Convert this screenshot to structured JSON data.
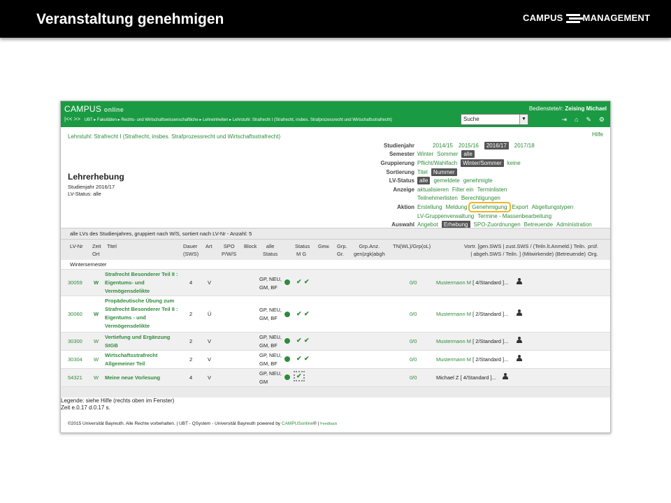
{
  "slide": {
    "title": "Veranstaltung genehmigen",
    "logo_text_left": "CAMPUS",
    "logo_text_right": "MANAGEMENT"
  },
  "app": {
    "logo_campus": "CAMPUS",
    "logo_online": "online",
    "user_label": "Bedienstete/r:",
    "user_name": "Zeising Michael",
    "breadcrumb": [
      "UBT",
      "Fakultäten",
      "Rechts- und Wirtschaftswissenschaftliche",
      "Lehreinheiten",
      "Lehrstuhl: Strafrecht I (Strafrecht, insbes. Strafprozessrecht und Wirtschaftsstrafrecht)"
    ],
    "search_value": "Suche",
    "hilfe": "Hilfe"
  },
  "lehrstuhl_title": "Lehrstuhl: Strafrecht I (Strafrecht, insbes. Strafprozessrecht und Wirtschaftsstrafrecht)",
  "page": {
    "heading": "Lehrerhebung",
    "sub1": "Studienjahr 2016/17",
    "sub2": "LV-Status: alle"
  },
  "controls": {
    "studienjahr": {
      "label": "Studienjahr",
      "options": [
        "2014/15",
        "2015/16",
        "2016/17",
        "2017/18"
      ],
      "selected": "2016/17"
    },
    "semester": {
      "label": "Semester",
      "options": [
        "Winter",
        "Sommer",
        "alle"
      ],
      "selected": "alle"
    },
    "gruppierung": {
      "label": "Gruppierung",
      "options": [
        "Pflicht/Wahlfach",
        "Winter/Sommer",
        "keine"
      ],
      "selected": "Winter/Sommer"
    },
    "sortierung": {
      "label": "Sortierung",
      "options": [
        "Titel",
        "Nummer"
      ],
      "selected": "Nummer"
    },
    "lvstatus": {
      "label": "LV-Status",
      "options": [
        "alle",
        "gemeldete",
        "genehmigte"
      ],
      "selected": "alle"
    },
    "anzeige": {
      "label": "Anzeige",
      "options": [
        "aktualisieren",
        "Filter ein",
        "Terminlisten"
      ],
      "options2": [
        "Teilnehmerlisten",
        "Berechtigungen"
      ]
    },
    "aktion": {
      "label": "Aktion",
      "options": [
        "Erstellung",
        "Meldung",
        "Genehmigung",
        "Export",
        "Abgeltungstypen"
      ],
      "options2": [
        "LV-Gruppenverwaltung",
        "Termine - Massenbearbeitung"
      ],
      "highlighted": "Genehmigung"
    },
    "auswahl": {
      "label": "Auswahl",
      "options": [
        "Angebot",
        "Erhebung",
        "SPO-Zuordnungen",
        "Betreuende",
        "Administration"
      ],
      "selected": "Erhebung"
    }
  },
  "table": {
    "summary": "alle LVs des Studienjahres, gruppiert nach W/S, sortiert nach LV-Nr - Anzahl: 5",
    "headers": {
      "lvnr": "LV-Nr",
      "zeit": "Zeit",
      "ort": "Ort",
      "titel": "Titel",
      "dauer": "Dauer",
      "dauer2": "(SWS)",
      "art": "Art",
      "spo": "SPO",
      "spo2": "P/W/S",
      "block": "Block",
      "allestatus": "alle",
      "allestatus2": "Status",
      "status": "Status",
      "status2": "M  G",
      "gew": "Gew.",
      "grp": "Grp.",
      "grp2": "Gr.",
      "grpanz": "Grp.Anz.",
      "grpanz2": "gen|zgk|abgh",
      "tn": "TN(WL)/Grp(oL)",
      "vortr": "Vortr. [gen.SWS | zust.SWS / (Teiln.lt.Anmeld.) Teiln.",
      "vortr2": "| abgeh.SWS / Teiln. ] (Mitwirkende) (Betreuende)",
      "pruef": "prüf.",
      "pruef2": "Org."
    },
    "semester_group": "Wintersemester",
    "rows": [
      {
        "nr": "30059",
        "zeit": "W",
        "title": [
          "Strafrecht Besonderer Teil II :",
          "Eigentums- und",
          "Vermögensdelikte"
        ],
        "dauer": "4",
        "art": "V",
        "status": [
          "GP, NEU,",
          "GM, BF"
        ],
        "tn": "0/0",
        "vortr_name": "Mustermann M",
        "vortr_detail": "[ 4/Standard ]..."
      },
      {
        "nr": "30060",
        "zeit": "W",
        "title": [
          "Propädeutische Übung zum",
          "Strafrecht Besonderer Teil II :",
          "Eigentums - und",
          "Vermögensdelikte"
        ],
        "dauer": "2",
        "art": "Ü",
        "status": [
          "GP, NEU,",
          "GM, BF"
        ],
        "tn": "0/0",
        "vortr_name": "Mustermann M",
        "vortr_detail": "[ 2/Standard ]..."
      },
      {
        "nr": "30300",
        "zeit": "W",
        "title": [
          "Vertiefung und Ergänzung",
          "StGB"
        ],
        "dauer": "2",
        "art": "V",
        "status": [
          "GP, NEU,",
          "GM, BF"
        ],
        "tn": "0/0",
        "vortr_name": "Mustermann M",
        "vortr_detail": "[ 2/Standard ]..."
      },
      {
        "nr": "30304",
        "zeit": "W",
        "title": [
          "Wirtschaftsstrafrecht",
          "Allgemeiner Teil"
        ],
        "dauer": "2",
        "art": "V",
        "status": [
          "GP, NEU,",
          "GM, BF"
        ],
        "tn": "0/0",
        "vortr_name": "Mustermann M",
        "vortr_detail": "[ 2/Standard ]..."
      },
      {
        "nr": "54321",
        "zeit": "W",
        "title": [
          "Meine neue Vorlesung"
        ],
        "dauer": "4",
        "art": "V",
        "status": [
          "GP, NEU,",
          "GM"
        ],
        "tn": "0/0",
        "vortr_name": "Michael Z",
        "vortr_detail": "[ 4/Standard ]..."
      }
    ]
  },
  "legend": {
    "line1": "Legende: siehe Hilfe (rechts oben im Fenster)",
    "line2": "Zeit e.0.17 d.0.17 s."
  },
  "footer": {
    "text": "©2015 Universität Bayreuth. Alle Rechte vorbehalten. | UBT - QSystem - Universität Bayreuth powered by",
    "link": "CAMPUSonline",
    "reg": "®",
    "sep": " | ",
    "feedback": "Feedback"
  },
  "icons": [
    "logout-icon",
    "home-icon",
    "edit-icon",
    "settings-icon",
    "person-icon",
    "check-icon"
  ],
  "colors": {
    "green": "#1a9a43",
    "highlight": "#f0b323"
  }
}
